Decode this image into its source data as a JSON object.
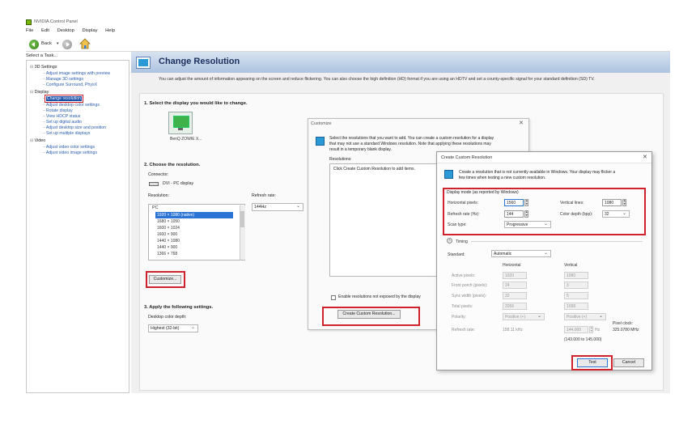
{
  "window": {
    "title": "NVIDIA Control Panel"
  },
  "menu": [
    "File",
    "Edit",
    "Desktop",
    "Display",
    "Help"
  ],
  "toolbar": {
    "back_label": "Back",
    "back_dropdown": "▾"
  },
  "sidebar": {
    "heading": "Select a Task...",
    "categories": [
      {
        "label": "3D Settings",
        "items": [
          "Adjust image settings with preview",
          "Manage 3D settings",
          "Configure Surround, PhysX"
        ]
      },
      {
        "label": "Display",
        "items": [
          "Change resolution",
          "Adjust desktop color settings",
          "Rotate display",
          "View HDCP status",
          "Set up digital audio",
          "Adjust desktop size and position",
          "Set up multiple displays"
        ]
      },
      {
        "label": "Video",
        "items": [
          "Adjust video color settings",
          "Adjust video image settings"
        ]
      }
    ]
  },
  "page": {
    "title": "Change Resolution",
    "description": "You can adjust the amount of information appearing on the screen and reduce flickering. You can also choose the high definition (HD) format if you are using an HDTV and set a county-specific signal for your standard definition (SD) TV."
  },
  "section1": {
    "heading": "1. Select the display you would like to change.",
    "display_label": "BenQ ZOWIE X..."
  },
  "section2": {
    "heading": "2. Choose the resolution.",
    "connector_label": "Connector:",
    "connector_value": "DVI - PC display",
    "resolution_label": "Resolution:",
    "refresh_label": "Refresh rate:",
    "refresh_value": "144Hz",
    "list_group": "PC",
    "resolutions": [
      "1920 × 1080 (native)",
      "1680 × 1050",
      "1600 × 1024",
      "1600 × 900",
      "1440 × 1080",
      "1440 × 900",
      "1366 × 768"
    ],
    "customize_button": "Customize..."
  },
  "section3": {
    "heading": "3. Apply the following settings.",
    "color_depth_label": "Desktop color depth:",
    "color_depth_value": "Highest (32-bit)"
  },
  "customize_dialog": {
    "title": "Customize",
    "description_line1": "Select the resolutions that you want to add. You can create a custom resolution for a display",
    "description_line2": "that may not use a standard Windows resolution. Note that applying these resolutions may",
    "description_line3": "result in a temporary blank display.",
    "resolutions_label": "Resolutions:",
    "hint": "Click Create Custom Resolution to add items.",
    "checkbox_label": "Enable resolutions not exposed by the display",
    "create_button": "Create Custom Resolution..."
  },
  "create_dialog": {
    "title": "Create Custom Resolution",
    "description_line1": "Create a resolution that is not currently available in Windows. Your display may flicker a",
    "description_line2": "few times when testing a new custom resolution.",
    "display_mode_heading": "Display mode (as reported by Windows)",
    "horizontal_label": "Horizontal pixels:",
    "horizontal_value": "1560",
    "vertical_label": "Vertical lines:",
    "vertical_value": "1080",
    "refresh_label": "Refresh rate (Hz):",
    "refresh_value": "144",
    "color_depth_label": "Color depth (bpp):",
    "color_depth_value": "32",
    "scan_label": "Scan type:",
    "scan_value": "Progressive",
    "timing_label": "Timing",
    "timing_toggle": "^",
    "standard_label": "Standard:",
    "standard_value": "Automatic",
    "col_horizontal": "Horizontal",
    "col_vertical": "Vertical",
    "rows": [
      {
        "label": "Active pixels:",
        "h": "1920",
        "v": "1080"
      },
      {
        "label": "Front porch (pixels):",
        "h": "24",
        "v": "3"
      },
      {
        "label": "Sync width (pixels):",
        "h": "32",
        "v": "5"
      },
      {
        "label": "Total pixels:",
        "h": "2056",
        "v": "1098"
      },
      {
        "label": "Polarity:",
        "h": "Positive (+)",
        "v": "Positive (+)"
      }
    ],
    "refresh_rate_label": "Refresh rate:",
    "refresh_rate_h": "158.11 kHz",
    "refresh_rate_v": "144.000",
    "refresh_rate_unit": "Hz",
    "refresh_range": "(143.000 to 145.000)",
    "pixel_clock_label": "Pixel clock:",
    "pixel_clock_value": "325.0780 MHz",
    "test_button": "Test",
    "cancel_button": "Cancel"
  }
}
